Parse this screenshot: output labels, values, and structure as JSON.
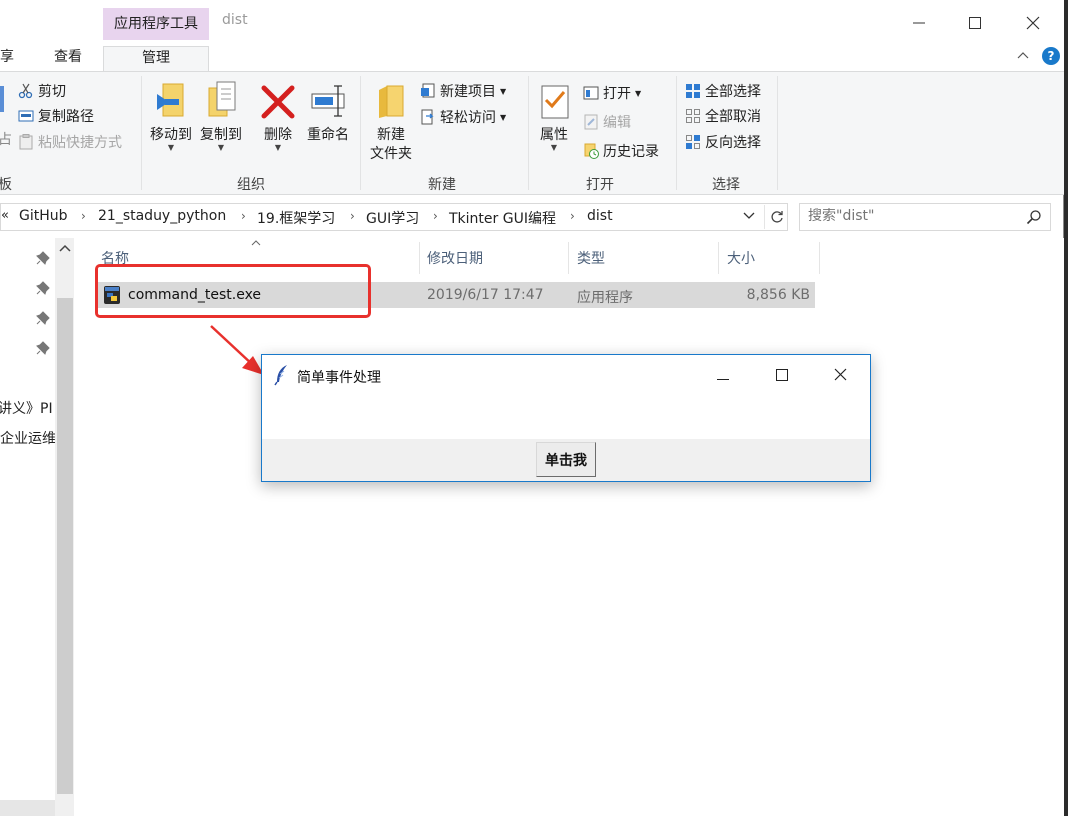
{
  "window": {
    "title": "dist",
    "contextual_tab_header": "应用程序工具",
    "controls": {
      "minimize": "—",
      "maximize": "☐",
      "close": "✕"
    }
  },
  "ribbon_tabs": [
    {
      "label": "共享",
      "visible_text": "享"
    },
    {
      "label": "查看"
    },
    {
      "label": "管理",
      "selected": true
    }
  ],
  "ribbon": {
    "clipboard": {
      "label_partial": "板",
      "cut": "剪切",
      "copy_path": "复制路径",
      "paste_shortcut": "粘贴快捷方式",
      "left_cut_text": "占"
    },
    "organize": {
      "label": "组织",
      "move_to": "移动到",
      "copy_to": "复制到",
      "delete": "删除",
      "rename": "重命名"
    },
    "new": {
      "label": "新建",
      "new_folder_line1": "新建",
      "new_folder_line2": "文件夹",
      "new_item": "新建项目",
      "easy_access": "轻松访问"
    },
    "open": {
      "label": "打开",
      "properties": "属性",
      "open": "打开",
      "edit": "编辑",
      "history": "历史记录"
    },
    "select": {
      "label": "选择",
      "select_all": "全部选择",
      "select_none": "全部取消",
      "invert": "反向选择"
    }
  },
  "address": {
    "overflow": "«",
    "crumbs": [
      "GitHub",
      "21_staduy_python",
      "19.框架学习",
      "GUI学习",
      "Tkinter GUI编程",
      "dist"
    ],
    "separator": "›"
  },
  "search": {
    "placeholder": "搜索\"dist\""
  },
  "nav": {
    "items": [
      "讲义》PI",
      "企业运维"
    ]
  },
  "columns": [
    "名称",
    "修改日期",
    "类型",
    "大小"
  ],
  "files": [
    {
      "name": "command_test.exe",
      "modified": "2019/6/17 17:47",
      "type": "应用程序",
      "size": "8,856 KB"
    }
  ],
  "annotation": {
    "color": "#e8312d"
  },
  "tk_dialog": {
    "title": "简单事件处理",
    "button": "单击我",
    "controls": {
      "minimize": "—",
      "maximize": "☐",
      "close": "✕"
    }
  },
  "colors": {
    "accent": "#1979ca",
    "contextual_tab": "#e8d4ee",
    "selection": "#d9d9d9",
    "ribbon_bg": "#f5f6f7"
  }
}
